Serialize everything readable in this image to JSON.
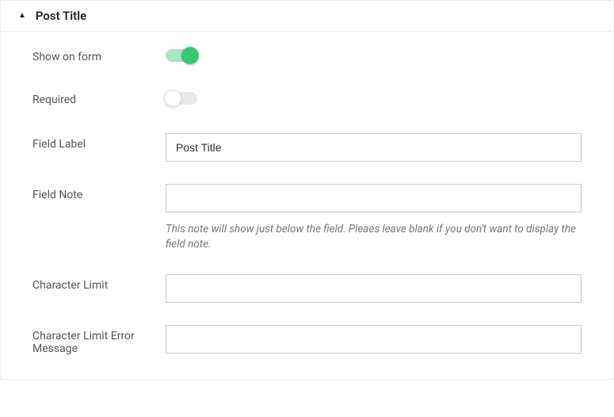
{
  "panel": {
    "title": "Post Title",
    "expanded": true
  },
  "fields": {
    "show_on_form": {
      "label": "Show on form",
      "value": true
    },
    "required": {
      "label": "Required",
      "value": false
    },
    "field_label": {
      "label": "Field Label",
      "value": "Post Title"
    },
    "field_note": {
      "label": "Field Note",
      "value": "",
      "help": "This note will show just below the field. Pleaes leave blank if you don't want to display the field note."
    },
    "character_limit": {
      "label": "Character Limit",
      "value": ""
    },
    "character_limit_error": {
      "label": "Character Limit Error Message",
      "value": ""
    }
  }
}
